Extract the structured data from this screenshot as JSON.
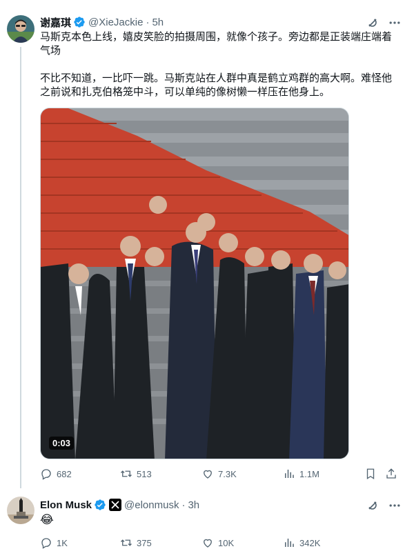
{
  "post": {
    "author_name": "谢嘉琪",
    "handle": "@XieJackie",
    "separator": "·",
    "time": "5h",
    "text_p1": "马斯克本色上线，嬉皮笑脸的拍摄周围，就像个孩子。旁边都是正装端庄端着气场",
    "text_p2": "不比不知道，一比吓一跳。马斯克站在人群中真是鹤立鸡群的高大啊。难怪他之前说和扎克伯格笼中斗，可以单纯的像树懒一样压在他身上。",
    "video_duration": "0:03",
    "replies": "682",
    "reposts": "513",
    "likes": "7.3K",
    "views": "1.1M"
  },
  "reply": {
    "author_name": "Elon Musk",
    "handle": "@elonmusk",
    "separator": "·",
    "time": "3h",
    "text": "😂",
    "replies": "1K",
    "reposts": "375",
    "likes": "10K",
    "views": "342K"
  },
  "icons": {
    "verified": "verified-badge-icon",
    "affiliate": "x-affiliate-icon",
    "grok": "grok-icon",
    "more": "more-icon",
    "reply": "reply-icon",
    "repost": "repost-icon",
    "like": "heart-icon",
    "views": "views-icon",
    "bookmark": "bookmark-icon",
    "share": "share-icon"
  },
  "colors": {
    "text": "#0f1419",
    "muted": "#536471",
    "verified": "#1d9bf0",
    "carpet": "#c7432f"
  }
}
